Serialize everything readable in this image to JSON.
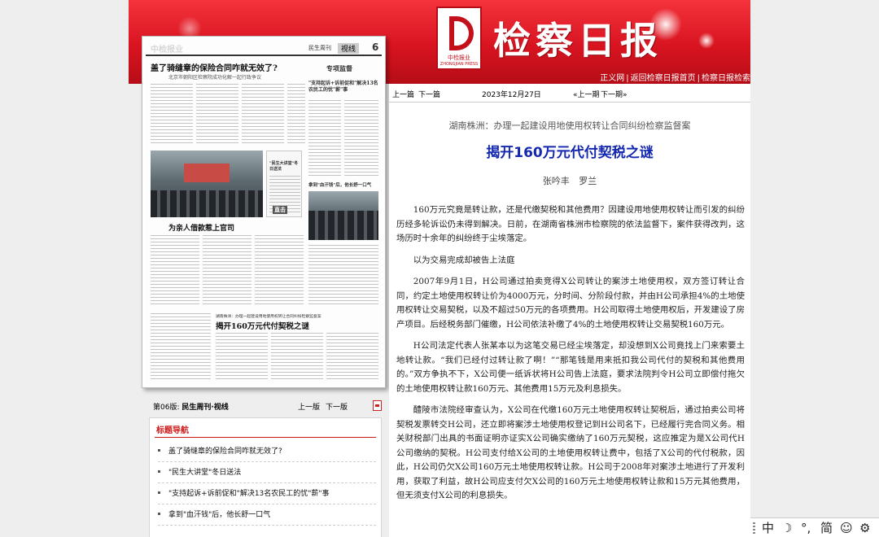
{
  "banner": {
    "paper_title": "检察日报",
    "logo_cn": "中检报业",
    "logo_en": "ZHONGJIAN PRESS",
    "links": [
      "正义网",
      "返回检察日报首页",
      "检察日报检索"
    ]
  },
  "thumbnail": {
    "brand": "中检报业",
    "section": "民生周刊",
    "tag": "视线",
    "page_no": "6",
    "headline_1": "盖了骑缝章的保险合同咋就无效了?",
    "headline_1_sub": "北京市朝阳区检察院成功化解一起行政争议",
    "sidebar_head": "专项监督",
    "sidebar_title": "\"支持起诉+诉前促和\"解决13名农民工的忧\"薪\"事",
    "headline_2": "为亲人借款惹上官司",
    "box_title": "\"民生大讲堂\"冬日送法",
    "small_caption": "拿到\"血汗钱\"后，他长舒一口气",
    "zhitong": "直击",
    "headline_3_kicker": "湖南株洲：办理一起建设用地使用权转让合同纠纷检察监督案",
    "headline_3": "揭开160万元代付契税之谜"
  },
  "page_nav": {
    "label_prefix": "第06版:",
    "label_name": "民生周刊·视线",
    "prev": "上一版",
    "next": "下一版"
  },
  "navbox": {
    "title": "标题导航",
    "items": [
      "盖了骑缝章的保险合同咋就无效了?",
      "\"民生大讲堂\"冬日送法",
      "\"支持起诉+诉前促和\"解决13名农民工的忧\"薪\"事",
      "拿到\"血汗钱\"后，他长舒一口气"
    ]
  },
  "article": {
    "toolbar": {
      "prev_article": "上一篇",
      "next_article": "下一篇",
      "date": "2023年12月27日",
      "prev_issue": "«上一期",
      "next_issue": "下一期»"
    },
    "kicker": "湖南株洲：办理一起建设用地使用权转让合同纠纷检察监督案",
    "title": "揭开160万元代付契税之谜",
    "authors": "张吟丰 罗兰",
    "paragraphs": [
      "160万元究竟是转让款，还是代缴契税和其他费用？因建设用地使用权转让而引发的纠纷历经多轮诉讼仍未得到解决。日前，在湖南省株洲市检察院的依法监督下，案件获得改判，这场历时十余年的纠纷终于尘埃落定。",
      "以为交易完成却被告上法庭",
      "2007年9月1日，H公司通过拍卖竞得X公司转让的案涉土地使用权，双方签订转让合同，约定土地使用权转让价为4000万元，分时间、分阶段付款，并由H公司承担4%的土地使用权转让交易契税，以及不超过50万元的各项费用。H公司取得土地使用权后，开发建设了房产项目。后经税务部门催缴，H公司依法补缴了4%的土地使用权转让交易契税160万元。",
      "H公司法定代表人张某本以为这笔交易已经尘埃落定，却没想到X公司竟找上门来索要土地转让款。“我们已经付过转让款了啊！”“那笔钱是用来抵扣我公司代付的契税和其他费用的。”双方争执不下，X公司便一纸诉状将H公司告上法庭，要求法院判令H公司立即偿付拖欠的土地使用权转让款160万元、其他费用15万元及利息损失。",
      "醴陵市法院经审查认为，X公司在代缴160万元土地使用权转让契税后，通过拍卖公司将契税发票转交H公司，还立即将案涉土地使用权登记到H公司名下，已经履行完合同义务。相关财税部门出具的书面证明亦证实X公司确实缴纳了160万元契税，这应推定为是X公司代H公司缴纳的契税。H公司支付给X公司的土地使用权转让费中，包括了X公司的代付税款，因此，H公司仍欠X公司160万元土地使用权转让款。H公司于2008年对案涉土地进行了开发利用，获取了利益，故H公司应支付欠X公司的160万元土地使用权转让款和15万元其他费用，但无须支付X公司的利息损失。"
    ]
  },
  "ime": {
    "mode": "中",
    "moon": "☽",
    "punct": "°,",
    "script": "简",
    "emoji": "☺",
    "settings": "⚙"
  }
}
